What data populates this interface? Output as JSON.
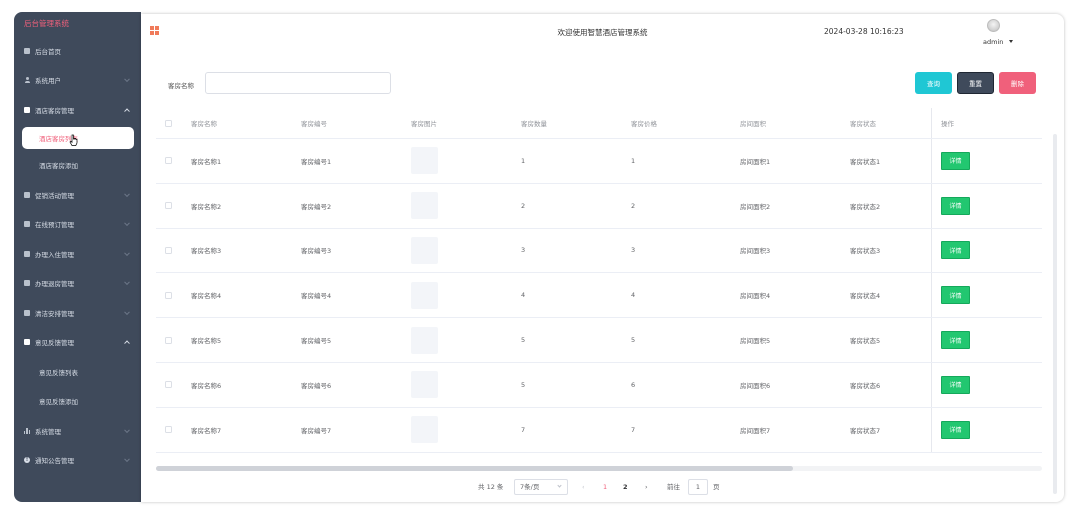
{
  "sidebar": {
    "brand": "后台管理系统",
    "items": [
      {
        "label": "后台首页"
      },
      {
        "label": "系统用户"
      },
      {
        "label": "酒店客房管理"
      },
      {
        "label": "酒店客房列表"
      },
      {
        "label": "酒店客房添加"
      },
      {
        "label": "促销活动管理"
      },
      {
        "label": "在线预订管理"
      },
      {
        "label": "办理入住管理"
      },
      {
        "label": "办理退房管理"
      },
      {
        "label": "清洁安排管理"
      },
      {
        "label": "意见反馈管理"
      },
      {
        "label": "意见反馈列表"
      },
      {
        "label": "意见反馈添加"
      },
      {
        "label": "系统管理"
      },
      {
        "label": "通知公告管理"
      }
    ]
  },
  "header": {
    "welcome": "欢迎使用智慧酒店管理系统",
    "datetime": "2024-03-28 10:16:23",
    "user": "admin"
  },
  "search": {
    "label": "客房名称",
    "value": "",
    "query_btn": "查询",
    "reset_btn": "重置",
    "delete_btn": "删除"
  },
  "table": {
    "columns": [
      "客房名称",
      "客房编号",
      "客房图片",
      "客房数量",
      "客房价格",
      "房间面积",
      "客房状态",
      "操作"
    ],
    "detail_label": "详情",
    "rows": [
      {
        "name": "客房名称1",
        "code": "客房编号1",
        "qty": "1",
        "price": "1",
        "area": "房间面积1",
        "status": "客房状态1"
      },
      {
        "name": "客房名称2",
        "code": "客房编号2",
        "qty": "2",
        "price": "2",
        "area": "房间面积2",
        "status": "客房状态2"
      },
      {
        "name": "客房名称3",
        "code": "客房编号3",
        "qty": "3",
        "price": "3",
        "area": "房间面积3",
        "status": "客房状态3"
      },
      {
        "name": "客房名称4",
        "code": "客房编号4",
        "qty": "4",
        "price": "4",
        "area": "房间面积4",
        "status": "客房状态4"
      },
      {
        "name": "客房名称5",
        "code": "客房编号5",
        "qty": "5",
        "price": "5",
        "area": "房间面积5",
        "status": "客房状态5"
      },
      {
        "name": "客房名称6",
        "code": "客房编号6",
        "qty": "5",
        "price": "6",
        "area": "房间面积6",
        "status": "客房状态6"
      },
      {
        "name": "客房名称7",
        "code": "客房编号7",
        "qty": "7",
        "price": "7",
        "area": "房间面积7",
        "status": "客房状态7"
      }
    ]
  },
  "pagination": {
    "total": "共 12 条",
    "page_size": "7条/页",
    "prev": "‹",
    "pages": [
      "1",
      "2"
    ],
    "next": "›",
    "goto_label": "前往",
    "goto_value": "1",
    "page_suffix": "页"
  },
  "colors": {
    "sidebar_bg": "#3f4a5b",
    "accent": "#f0607b",
    "query": "#1fc7d4",
    "detail": "#22c770"
  }
}
